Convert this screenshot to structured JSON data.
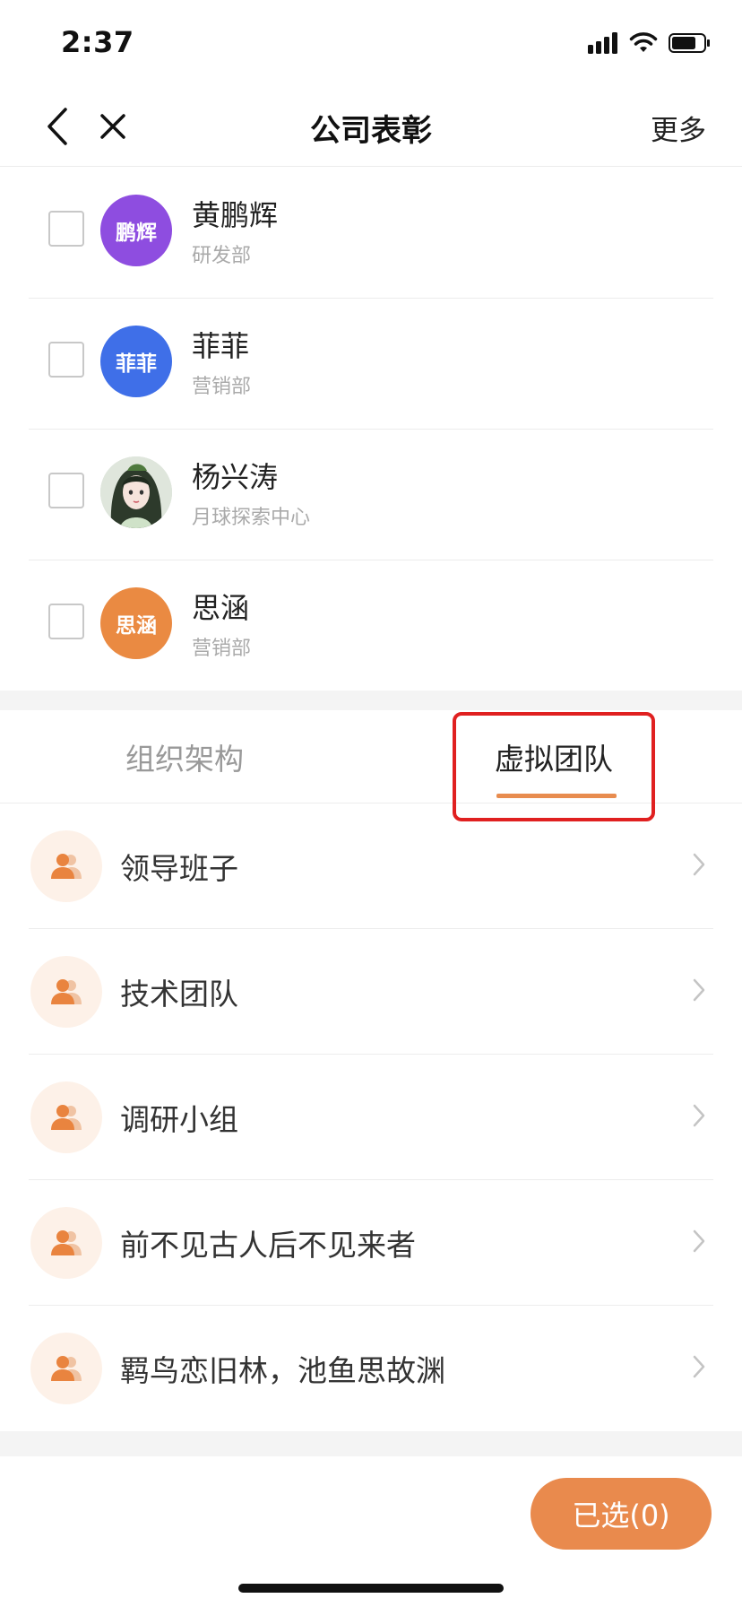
{
  "status_bar": {
    "time": "2:37"
  },
  "nav": {
    "title": "公司表彰",
    "more": "更多"
  },
  "members": [
    {
      "name": "黄鹏辉",
      "dept": "研发部",
      "avatar_text": "鹏辉",
      "avatar_color": "#8e4de0"
    },
    {
      "name": "菲菲",
      "dept": "营销部",
      "avatar_text": "菲菲",
      "avatar_color": "#3f6fe8"
    },
    {
      "name": "杨兴涛",
      "dept": "月球探索中心",
      "avatar_text": "",
      "avatar_color": "#cfd9cf"
    },
    {
      "name": "思涵",
      "dept": "营销部",
      "avatar_text": "思涵",
      "avatar_color": "#ea8a42"
    }
  ],
  "tabs": {
    "org": "组织架构",
    "virtual": "虚拟团队",
    "active": "virtual"
  },
  "teams": [
    {
      "name": "领导班子"
    },
    {
      "name": "技术团队"
    },
    {
      "name": "调研小组"
    },
    {
      "name": "前不见古人后不见来者"
    },
    {
      "name": "羁鸟恋旧林，池鱼思故渊"
    }
  ],
  "footer": {
    "selected_label": "已选(0)"
  },
  "colors": {
    "accent": "#e98a4d",
    "highlight": "#e02020"
  }
}
